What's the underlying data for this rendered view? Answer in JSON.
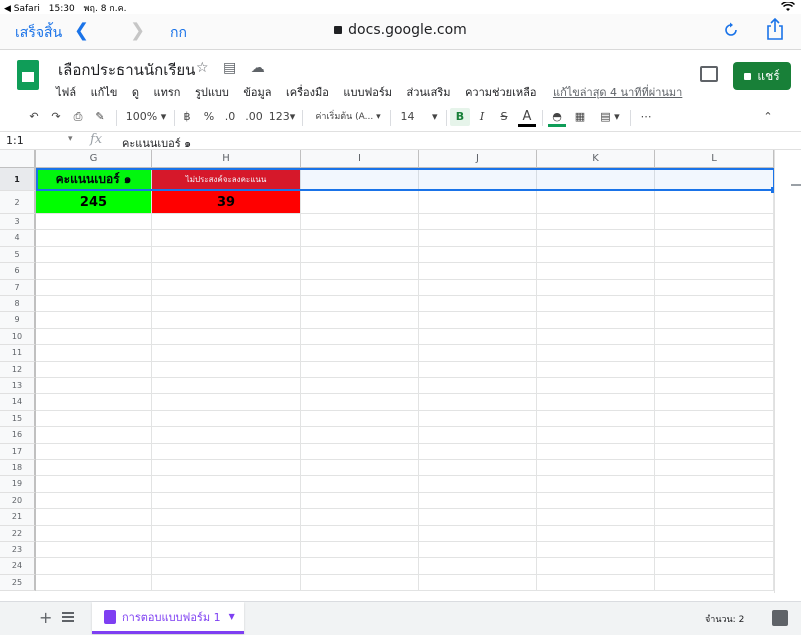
{
  "status": {
    "back_app": "◀ Safari",
    "time": "15:30",
    "date": "พฤ. 8 ก.ค."
  },
  "safari": {
    "done": "เสร็จสิ้น",
    "text_size": "กก",
    "url": "docs.google.com"
  },
  "doc": {
    "title": "เลือกประธานนักเรียน",
    "menu": [
      "ไฟล์",
      "แก้ไข",
      "ดู",
      "แทรก",
      "รูปแบบ",
      "ข้อมูล",
      "เครื่องมือ",
      "แบบฟอร์ม",
      "ส่วนเสริม",
      "ความช่วยเหลือ"
    ],
    "last_edit": "แก้ไขล่าสุด 4 นาทีที่ผ่านมา",
    "share": "แชร์"
  },
  "toolbar": {
    "zoom": "100%",
    "currency": "฿",
    "percent": "%",
    "dec_less": ".0",
    "dec_more": ".00",
    "format_more": "123",
    "font": "ค่าเริ่มต้น (A...",
    "font_size": "14",
    "bold": "B",
    "italic": "I",
    "strike": "S",
    "text_color": "A",
    "more": "⋯"
  },
  "formula": {
    "cell_ref": "1:1",
    "fx": "fx",
    "content": "คะแนนเบอร์ ๑"
  },
  "grid": {
    "columns": [
      "G",
      "H",
      "I",
      "J",
      "K",
      "L"
    ],
    "rows": [
      "1",
      "2",
      "3",
      "4",
      "5",
      "6",
      "7",
      "8",
      "9",
      "10",
      "11",
      "12",
      "13",
      "14",
      "15",
      "16",
      "17",
      "18",
      "19",
      "20",
      "21",
      "22",
      "23",
      "24",
      "25"
    ],
    "G1": "คะแนนเบอร์ ๑",
    "H1": "ไม่ประสงค์จะลงคะแนน",
    "G2": "245",
    "H2": "39",
    "colors": {
      "green": "#00ff00",
      "red": "#ff0000",
      "selection": "#1a73e8"
    }
  },
  "bottom": {
    "add": "+",
    "sheet_name": "การตอบแบบฟอร์ม 1",
    "count": "จำนวน: 2"
  }
}
